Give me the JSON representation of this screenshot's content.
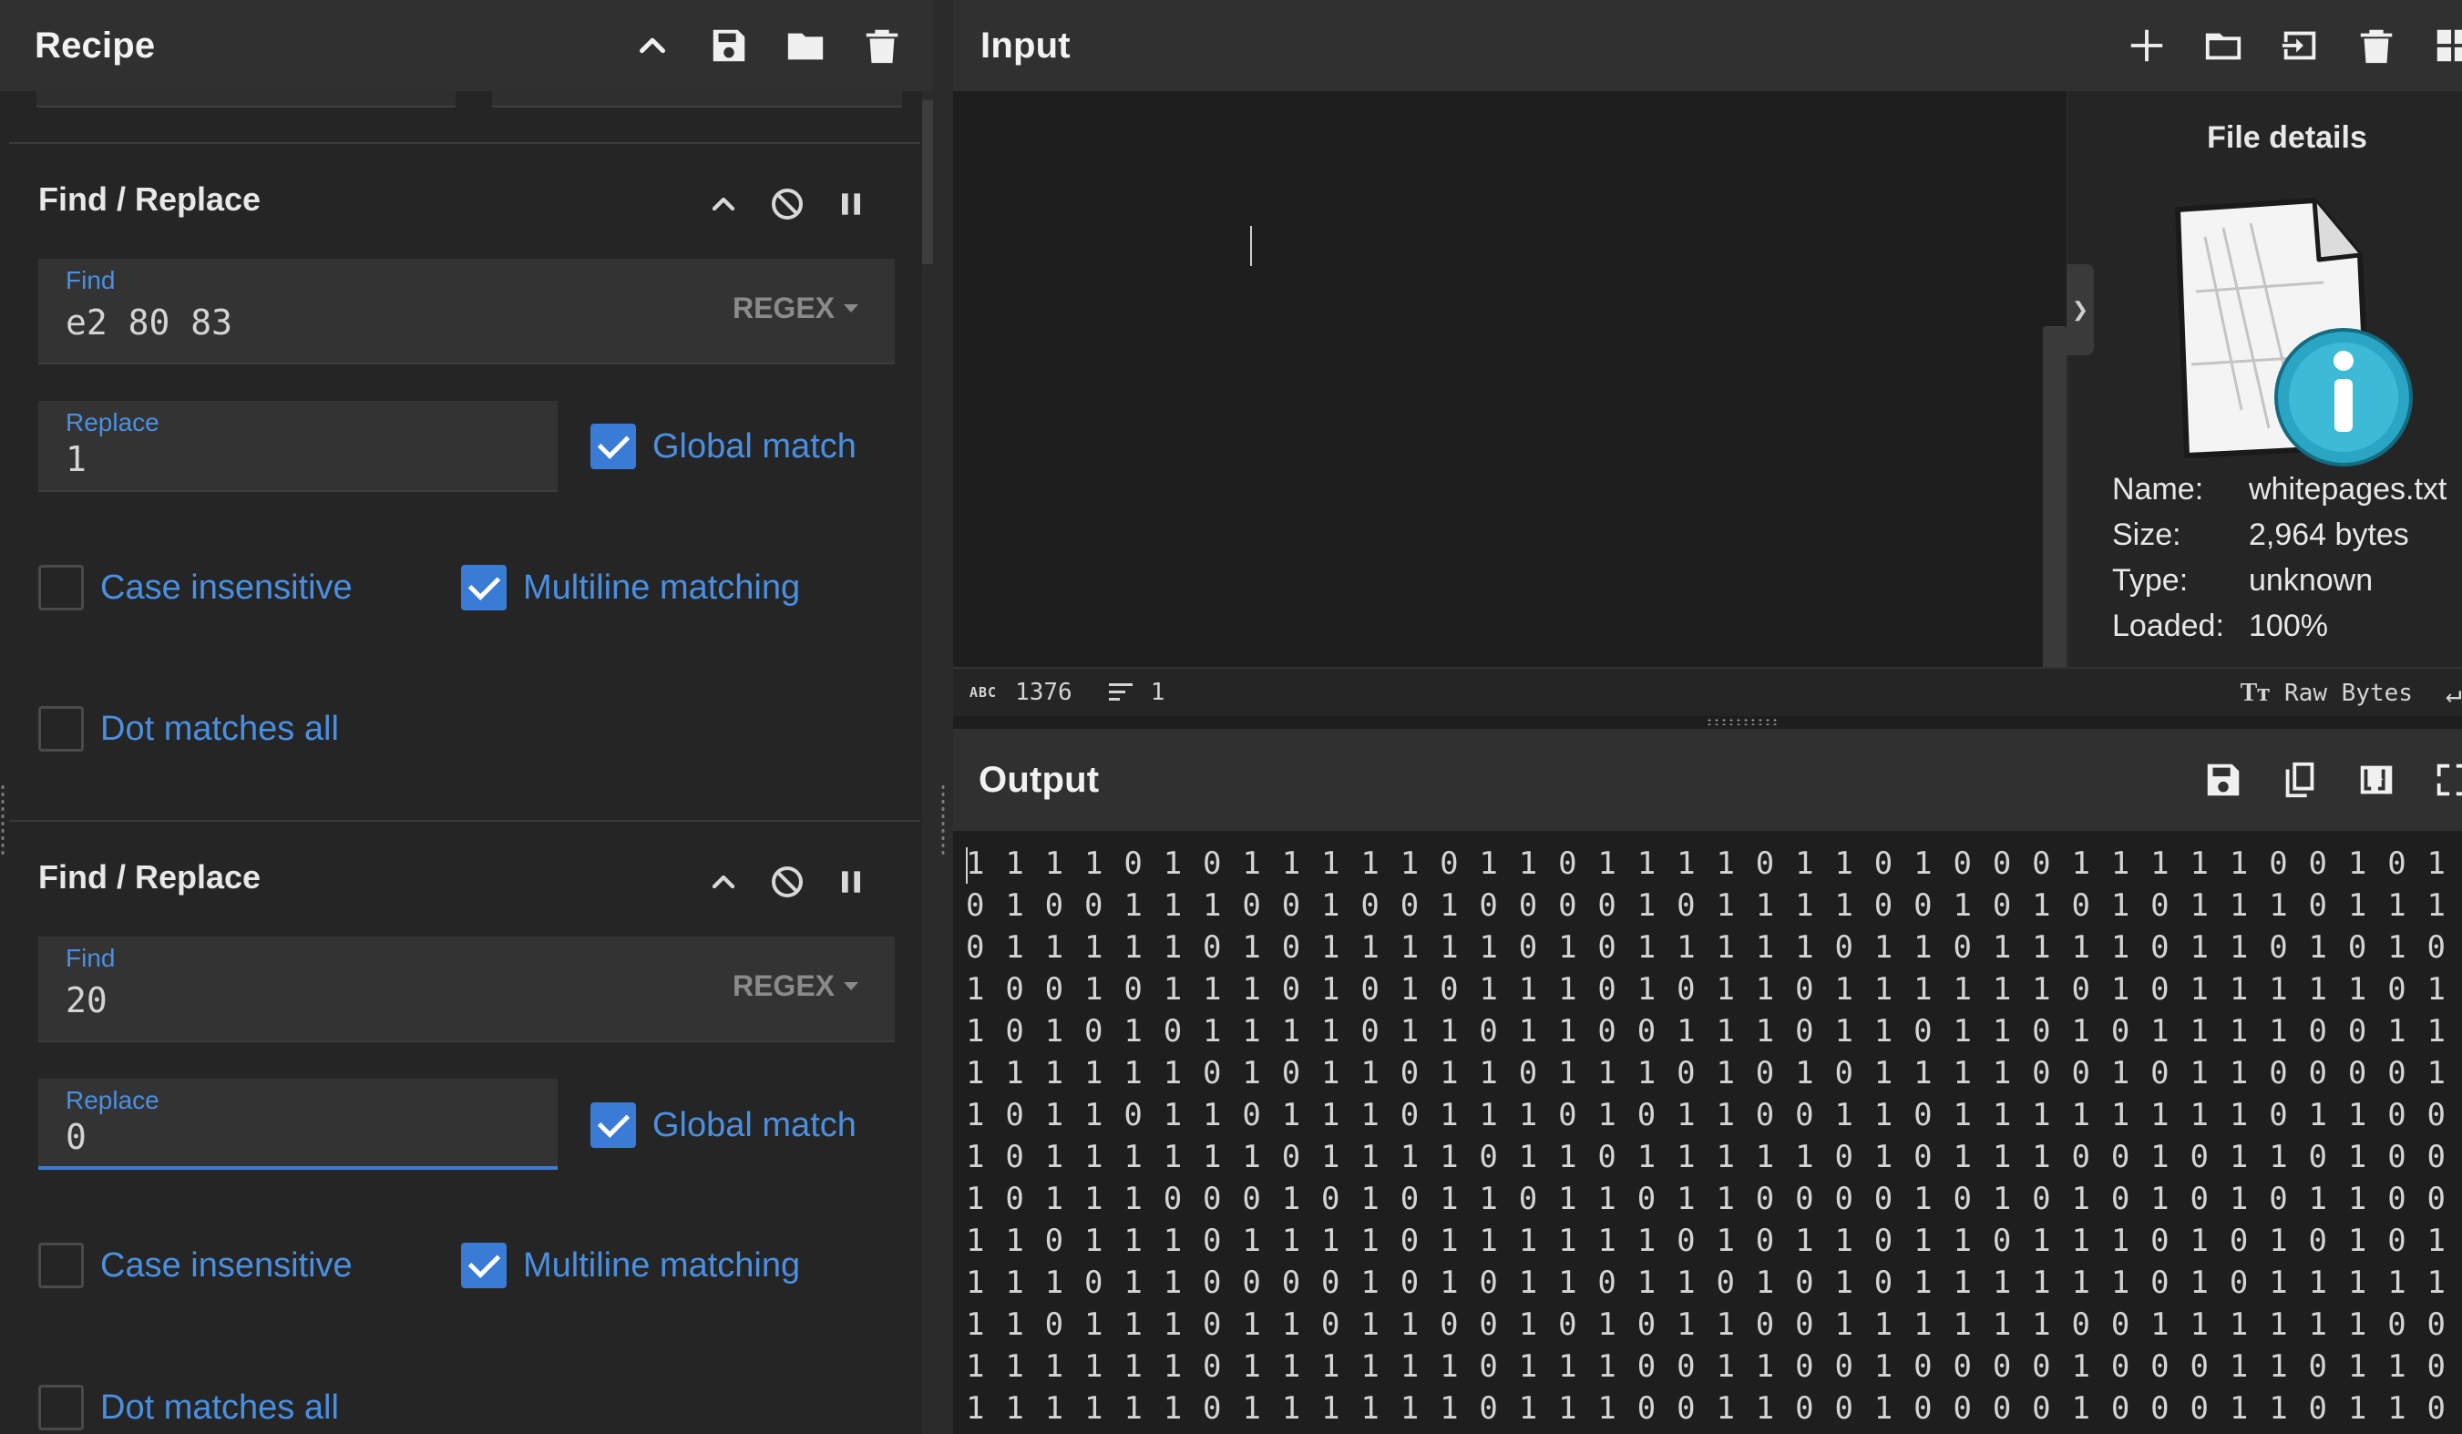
{
  "recipe": {
    "title": "Recipe",
    "header_icons": [
      "chevron-up-icon",
      "save-icon",
      "folder-icon",
      "trash-icon"
    ],
    "operations": [
      {
        "title": "Find / Replace",
        "find_label": "Find",
        "find_value": "e2 80 83",
        "find_mode": "REGEX",
        "replace_label": "Replace",
        "replace_value": "1",
        "global_match": {
          "label": "Global match",
          "checked": true
        },
        "case_insensitive": {
          "label": "Case insensitive",
          "checked": false
        },
        "multiline": {
          "label": "Multiline matching",
          "checked": true
        },
        "dot_all": {
          "label": "Dot matches all",
          "checked": false
        }
      },
      {
        "title": "Find / Replace",
        "find_label": "Find",
        "find_value": "20",
        "find_mode": "REGEX",
        "replace_label": "Replace",
        "replace_value": "0",
        "global_match": {
          "label": "Global match",
          "checked": true
        },
        "case_insensitive": {
          "label": "Case insensitive",
          "checked": false
        },
        "multiline": {
          "label": "Multiline matching",
          "checked": true
        },
        "dot_all": {
          "label": "Dot matches all",
          "checked": false
        }
      }
    ]
  },
  "input": {
    "title": "Input",
    "header_icons": [
      "plus-icon",
      "folder-icon",
      "import-icon",
      "trash-icon",
      "layout-icon"
    ],
    "file_details": {
      "title": "File details",
      "name_label": "Name:",
      "name": "whitepages.txt",
      "size_label": "Size:",
      "size": "2,964 bytes",
      "type_label": "Type:",
      "type": "unknown",
      "loaded_label": "Loaded:",
      "loaded": "100%"
    },
    "status": {
      "abc": "ABC",
      "length": "1376",
      "lines": "1",
      "encoding": "Raw Bytes"
    }
  },
  "output": {
    "title": "Output",
    "header_icons": [
      "save-icon",
      "copy-icon",
      "replace-input-icon",
      "maximize-icon"
    ],
    "lines": [
      "1 1 1 1 0 1 0 1 1 1 1 1 0 1 1 0 1 1 1 1 0 1 1 0 1 0 0 0 1 1 1 1 1 0 0 1 0 1 1",
      "0 1 0 0 1 1 1 0 0 1 0 0 1 0 0 0 0 1 0 1 1 1 1 0 0 1 0 1 0 1 0 1 1 1 0 1 1 1 0",
      "0 1 1 1 1 1 0 1 0 1 1 1 1 1 0 1 0 1 1 1 1 1 0 1 1 0 1 1 1 1 0 1 1 0 1 0 1 0 1",
      "1 0 0 1 0 1 1 1 0 1 0 1 0 1 1 1 0 1 0 1 1 0 1 1 1 1 1 1 0 1 0 1 1 1 1 1 0 1 0",
      "1 0 1 0 1 0 1 1 1 1 0 1 1 0 1 1 0 0 1 1 1 0 1 1 0 1 1 0 1 0 1 1 1 1 0 0 1 1 0",
      "1 1 1 1 1 1 0 1 0 1 1 0 1 1 0 1 1 1 0 1 0 1 0 1 1 1 1 0 0 1 0 1 1 0 0 0 0 1 0",
      "1 0 1 1 0 1 1 0 1 1 1 0 1 1 1 0 1 0 1 1 0 0 1 1 0 1 1 1 1 1 1 1 1 0 1 1 0 0 1 1",
      "1 0 1 1 1 1 1 1 0 1 1 1 1 0 1 1 0 1 1 1 1 1 0 1 0 1 1 1 0 0 1 0 1 1 0 1 0 0",
      "1 0 1 1 1 0 0 0 1 0 1 0 1 1 0 1 1 0 1 1 0 0 0 0 1 0 1 0 1 0 1 0 1 0 1 1 0 0 0",
      "1 1 0 1 1 1 0 1 1 1 1 0 1 1 1 1 1 1 0 1 0 1 1 0 1 1 0 1 1 1 0 1 0 1 0 1 0 1 1",
      "1 1 1 0 1 1 0 0 0 0 1 0 1 0 1 1 0 1 1 0 1 0 1 0 1 1 1 1 1 1 0 1 0 1 1 1 1 1 0",
      "1 1 0 1 1 1 0 1 1 0 1 1 0 0 1 0 1 0 1 1 0 0 1 1 1 1 1 1 0 0 1 1 1 1 1 1 0 0",
      "1 1 1 1 1 1 0 1 1 1 1 1 1 0 1 1 1 0 0 1 1 0 0 1 0 0 0 0 1 0 0 0 1 1 0 1 1 0 0",
      "1 1 1 1 1 1 0 1 1 1 1 1 1 0 1 1 1 0 0 1 1 0 0 1 0 0 0 0 1 0 0 0 1 1 0 1 1 0 0"
    ]
  },
  "colors": {
    "accent": "#3a7bd5",
    "label_blue": "#4a90e2",
    "panel_header": "#303030",
    "background": "#1e1e1e"
  }
}
